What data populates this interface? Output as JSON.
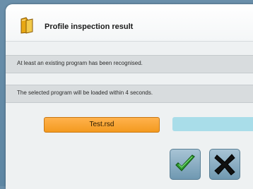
{
  "dialog": {
    "title": "Profile inspection result",
    "title_icon": "folder-icon",
    "message_1": "At least an existing program has been recognised.",
    "message_2": "The selected program will be loaded within 4 seconds."
  },
  "actions": {
    "test_label": "Test.rsd",
    "confirm_icon": "checkmark-icon",
    "cancel_icon": "cross-icon"
  },
  "progress": {
    "fraction": 0.0
  },
  "colors": {
    "accent_orange": "#f39a1f",
    "progress_blue": "#a9dde9",
    "confirm_green": "#2e9b2e"
  }
}
